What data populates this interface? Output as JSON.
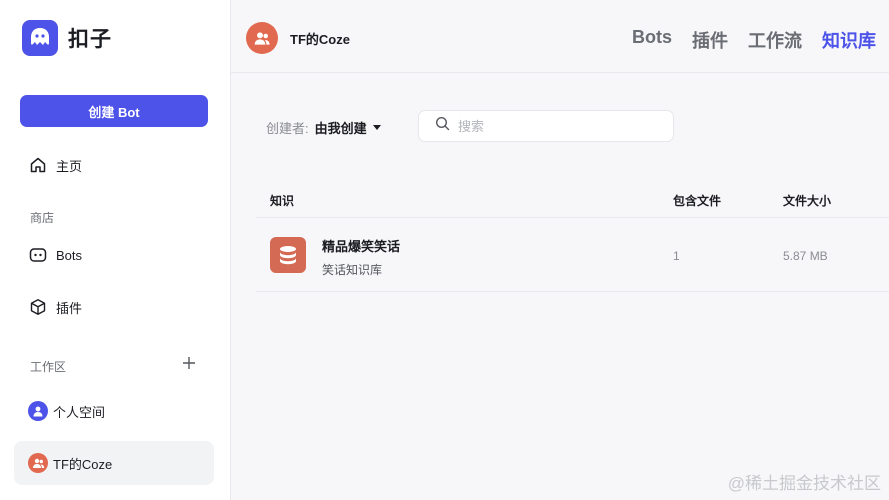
{
  "brand": {
    "name": "扣子",
    "accent": "#4d53e8"
  },
  "sidebar": {
    "create_button": "创建 Bot",
    "home": "主页",
    "store_section": "商店",
    "store_items": [
      {
        "label": "Bots",
        "icon": "bot-icon"
      },
      {
        "label": "插件",
        "icon": "cube-icon"
      }
    ],
    "workspace_section": "工作区",
    "spaces": [
      {
        "label": "个人空间",
        "avatar_color": "#4d53e8"
      },
      {
        "label": "TF的Coze",
        "avatar_color": "#e06950"
      }
    ]
  },
  "header": {
    "team_name": "TF的Coze",
    "tabs": [
      "Bots",
      "插件",
      "工作流",
      "知识库"
    ],
    "active_tab": "知识库"
  },
  "filter": {
    "label": "创建者:",
    "value": "由我创建",
    "search_placeholder": "搜索"
  },
  "table": {
    "columns": [
      "知识",
      "包含文件",
      "文件大小"
    ],
    "rows": [
      {
        "name": "精品爆笑笑话",
        "description": "笑话知识库",
        "files": "1",
        "size": "5.87 MB"
      }
    ]
  },
  "watermark": "@稀土掘金技术社区"
}
